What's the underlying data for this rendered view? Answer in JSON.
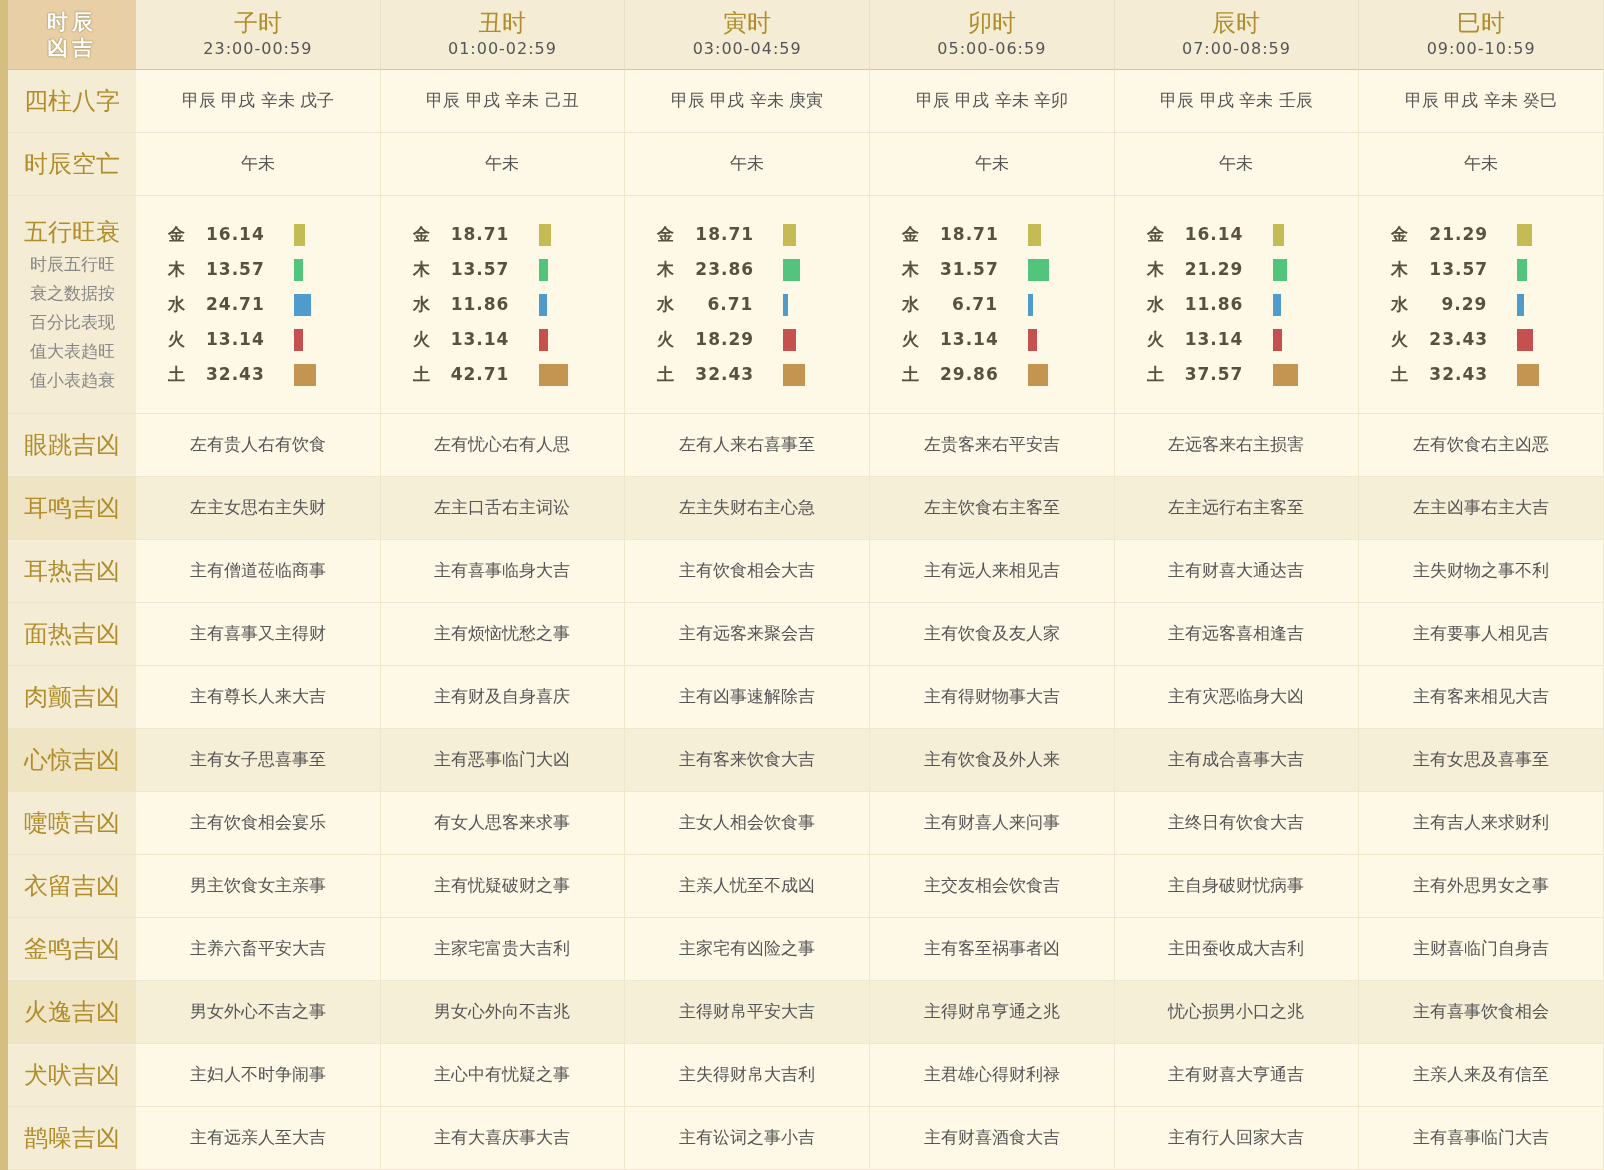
{
  "corner": [
    "时辰",
    "凶吉"
  ],
  "columns": [
    {
      "name": "子时",
      "time": "23:00-00:59"
    },
    {
      "name": "丑时",
      "time": "01:00-02:59"
    },
    {
      "name": "寅时",
      "time": "03:00-04:59"
    },
    {
      "name": "卯时",
      "time": "05:00-06:59"
    },
    {
      "name": "辰时",
      "time": "07:00-08:59"
    },
    {
      "name": "巳时",
      "time": "09:00-10:59"
    }
  ],
  "rows": [
    {
      "label": "四柱八字",
      "kind": "text",
      "shaded": false,
      "cells": [
        "甲辰 甲戌 辛未 戊子",
        "甲辰 甲戌 辛未 己丑",
        "甲辰 甲戌 辛未 庚寅",
        "甲辰 甲戌 辛未 辛卯",
        "甲辰 甲戌 辛未 壬辰",
        "甲辰 甲戌 辛未 癸巳"
      ]
    },
    {
      "label": "时辰空亡",
      "kind": "text",
      "shaded": false,
      "cells": [
        "午未",
        "午未",
        "午未",
        "午未",
        "午未",
        "午未"
      ]
    },
    {
      "label": "五行旺衰",
      "kind": "wuxing",
      "shaded": false,
      "notes": [
        "时辰五行旺",
        "衰之数据按",
        "百分比表现",
        "值大表趋旺",
        "值小表趋衰"
      ],
      "cells": [
        [
          {
            "name": "金",
            "value": "16.14",
            "color": "#c4bb55"
          },
          {
            "name": "木",
            "value": "13.57",
            "color": "#52c47c"
          },
          {
            "name": "水",
            "value": "24.71",
            "color": "#4f9ccc"
          },
          {
            "name": "火",
            "value": "13.14",
            "color": "#c65050"
          },
          {
            "name": "土",
            "value": "32.43",
            "color": "#c49550"
          }
        ],
        [
          {
            "name": "金",
            "value": "18.71",
            "color": "#c4bb55"
          },
          {
            "name": "木",
            "value": "13.57",
            "color": "#52c47c"
          },
          {
            "name": "水",
            "value": "11.86",
            "color": "#4f9ccc"
          },
          {
            "name": "火",
            "value": "13.14",
            "color": "#c65050"
          },
          {
            "name": "土",
            "value": "42.71",
            "color": "#c49550"
          }
        ],
        [
          {
            "name": "金",
            "value": "18.71",
            "color": "#c4bb55"
          },
          {
            "name": "木",
            "value": "23.86",
            "color": "#52c47c"
          },
          {
            "name": "水",
            "value": "6.71",
            "color": "#4f9ccc"
          },
          {
            "name": "火",
            "value": "18.29",
            "color": "#c65050"
          },
          {
            "name": "土",
            "value": "32.43",
            "color": "#c49550"
          }
        ],
        [
          {
            "name": "金",
            "value": "18.71",
            "color": "#c4bb55"
          },
          {
            "name": "木",
            "value": "31.57",
            "color": "#52c47c"
          },
          {
            "name": "水",
            "value": "6.71",
            "color": "#4f9ccc"
          },
          {
            "name": "火",
            "value": "13.14",
            "color": "#c65050"
          },
          {
            "name": "土",
            "value": "29.86",
            "color": "#c49550"
          }
        ],
        [
          {
            "name": "金",
            "value": "16.14",
            "color": "#c4bb55"
          },
          {
            "name": "木",
            "value": "21.29",
            "color": "#52c47c"
          },
          {
            "name": "水",
            "value": "11.86",
            "color": "#4f9ccc"
          },
          {
            "name": "火",
            "value": "13.14",
            "color": "#c65050"
          },
          {
            "name": "土",
            "value": "37.57",
            "color": "#c49550"
          }
        ],
        [
          {
            "name": "金",
            "value": "21.29",
            "color": "#c4bb55"
          },
          {
            "name": "木",
            "value": "13.57",
            "color": "#52c47c"
          },
          {
            "name": "水",
            "value": "9.29",
            "color": "#4f9ccc"
          },
          {
            "name": "火",
            "value": "23.43",
            "color": "#c65050"
          },
          {
            "name": "土",
            "value": "32.43",
            "color": "#c49550"
          }
        ]
      ]
    },
    {
      "label": "眼跳吉凶",
      "kind": "text",
      "shaded": false,
      "cells": [
        "左有贵人右有饮食",
        "左有忧心右有人思",
        "左有人来右喜事至",
        "左贵客来右平安吉",
        "左远客来右主损害",
        "左有饮食右主凶恶"
      ]
    },
    {
      "label": "耳鸣吉凶",
      "kind": "text",
      "shaded": true,
      "cells": [
        "左主女思右主失财",
        "左主口舌右主词讼",
        "左主失财右主心急",
        "左主饮食右主客至",
        "左主远行右主客至",
        "左主凶事右主大吉"
      ]
    },
    {
      "label": "耳热吉凶",
      "kind": "text",
      "shaded": false,
      "cells": [
        "主有僧道莅临商事",
        "主有喜事临身大吉",
        "主有饮食相会大吉",
        "主有远人来相见吉",
        "主有财喜大通达吉",
        "主失财物之事不利"
      ]
    },
    {
      "label": "面热吉凶",
      "kind": "text",
      "shaded": false,
      "cells": [
        "主有喜事又主得财",
        "主有烦恼忧愁之事",
        "主有远客来聚会吉",
        "主有饮食及友人家",
        "主有远客喜相逢吉",
        "主有要事人相见吉"
      ]
    },
    {
      "label": "肉颤吉凶",
      "kind": "text",
      "shaded": false,
      "cells": [
        "主有尊长人来大吉",
        "主有财及自身喜庆",
        "主有凶事速解除吉",
        "主有得财物事大吉",
        "主有灾恶临身大凶",
        "主有客来相见大吉"
      ]
    },
    {
      "label": "心惊吉凶",
      "kind": "text",
      "shaded": true,
      "cells": [
        "主有女子思喜事至",
        "主有恶事临门大凶",
        "主有客来饮食大吉",
        "主有饮食及外人来",
        "主有成合喜事大吉",
        "主有女思及喜事至"
      ]
    },
    {
      "label": "嚏喷吉凶",
      "kind": "text",
      "shaded": false,
      "cells": [
        "主有饮食相会宴乐",
        "有女人思客来求事",
        "主女人相会饮食事",
        "主有财喜人来问事",
        "主终日有饮食大吉",
        "主有吉人来求财利"
      ]
    },
    {
      "label": "衣留吉凶",
      "kind": "text",
      "shaded": false,
      "cells": [
        "男主饮食女主亲事",
        "主有忧疑破财之事",
        "主亲人忧至不成凶",
        "主交友相会饮食吉",
        "主自身破财忧病事",
        "主有外思男女之事"
      ]
    },
    {
      "label": "釜鸣吉凶",
      "kind": "text",
      "shaded": false,
      "cells": [
        "主养六畜平安大吉",
        "主家宅富贵大吉利",
        "主家宅有凶险之事",
        "主有客至祸事者凶",
        "主田蚕收成大吉利",
        "主财喜临门自身吉"
      ]
    },
    {
      "label": "火逸吉凶",
      "kind": "text",
      "shaded": true,
      "cells": [
        "男女外心不吉之事",
        "男女心外向不吉兆",
        "主得财帛平安大吉",
        "主得财帛亨通之兆",
        "忧心损男小口之兆",
        "主有喜事饮食相会"
      ]
    },
    {
      "label": "犬吠吉凶",
      "kind": "text",
      "shaded": false,
      "cells": [
        "主妇人不时争闹事",
        "主心中有忧疑之事",
        "主失得财帛大吉利",
        "主君雄心得财利禄",
        "主有财喜大亨通吉",
        "主亲人来及有信至"
      ]
    },
    {
      "label": "鹊噪吉凶",
      "kind": "text",
      "shaded": false,
      "cells": [
        "主有远亲人至大吉",
        "主有大喜庆事大吉",
        "主有讼词之事小吉",
        "主有财喜酒食大吉",
        "主有行人回家大吉",
        "主有喜事临门大吉"
      ]
    }
  ]
}
